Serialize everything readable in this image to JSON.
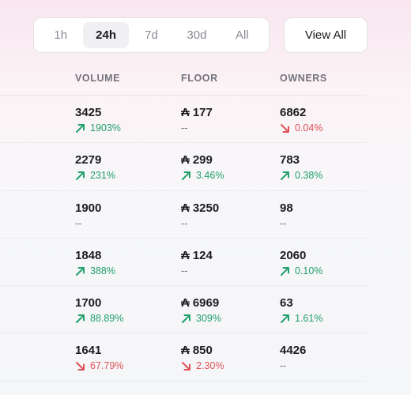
{
  "timeframe": {
    "options": [
      "1h",
      "24h",
      "7d",
      "30d",
      "All"
    ],
    "selected": "24h"
  },
  "view_all_label": "View All",
  "columns": {
    "volume": "VOLUME",
    "floor": "FLOOR",
    "owners": "OWNERS"
  },
  "currency_symbol": "₳",
  "colors": {
    "up": "#22a06b",
    "down": "#e05258",
    "neutral": "#6a6a72"
  },
  "rows": [
    {
      "volume": "3425",
      "volume_change": "1903%",
      "volume_dir": "up",
      "floor": "177",
      "floor_change": "--",
      "floor_dir": "none",
      "owners": "6862",
      "owners_change": "0.04%",
      "owners_dir": "down"
    },
    {
      "volume": "2279",
      "volume_change": "231%",
      "volume_dir": "up",
      "floor": "299",
      "floor_change": "3.46%",
      "floor_dir": "up",
      "owners": "783",
      "owners_change": "0.38%",
      "owners_dir": "up"
    },
    {
      "volume": "1900",
      "volume_change": "--",
      "volume_dir": "none",
      "floor": "3250",
      "floor_change": "--",
      "floor_dir": "none",
      "owners": "98",
      "owners_change": "--",
      "owners_dir": "none"
    },
    {
      "volume": "1848",
      "volume_change": "388%",
      "volume_dir": "up",
      "floor": "124",
      "floor_change": "--",
      "floor_dir": "none",
      "owners": "2060",
      "owners_change": "0.10%",
      "owners_dir": "up"
    },
    {
      "volume": "1700",
      "volume_change": "88.89%",
      "volume_dir": "up",
      "floor": "6969",
      "floor_change": "309%",
      "floor_dir": "up",
      "owners": "63",
      "owners_change": "1.61%",
      "owners_dir": "up"
    },
    {
      "volume": "1641",
      "volume_change": "67.79%",
      "volume_dir": "down",
      "floor": "850",
      "floor_change": "2.30%",
      "floor_dir": "down",
      "owners": "4426",
      "owners_change": "--",
      "owners_dir": "none"
    }
  ]
}
